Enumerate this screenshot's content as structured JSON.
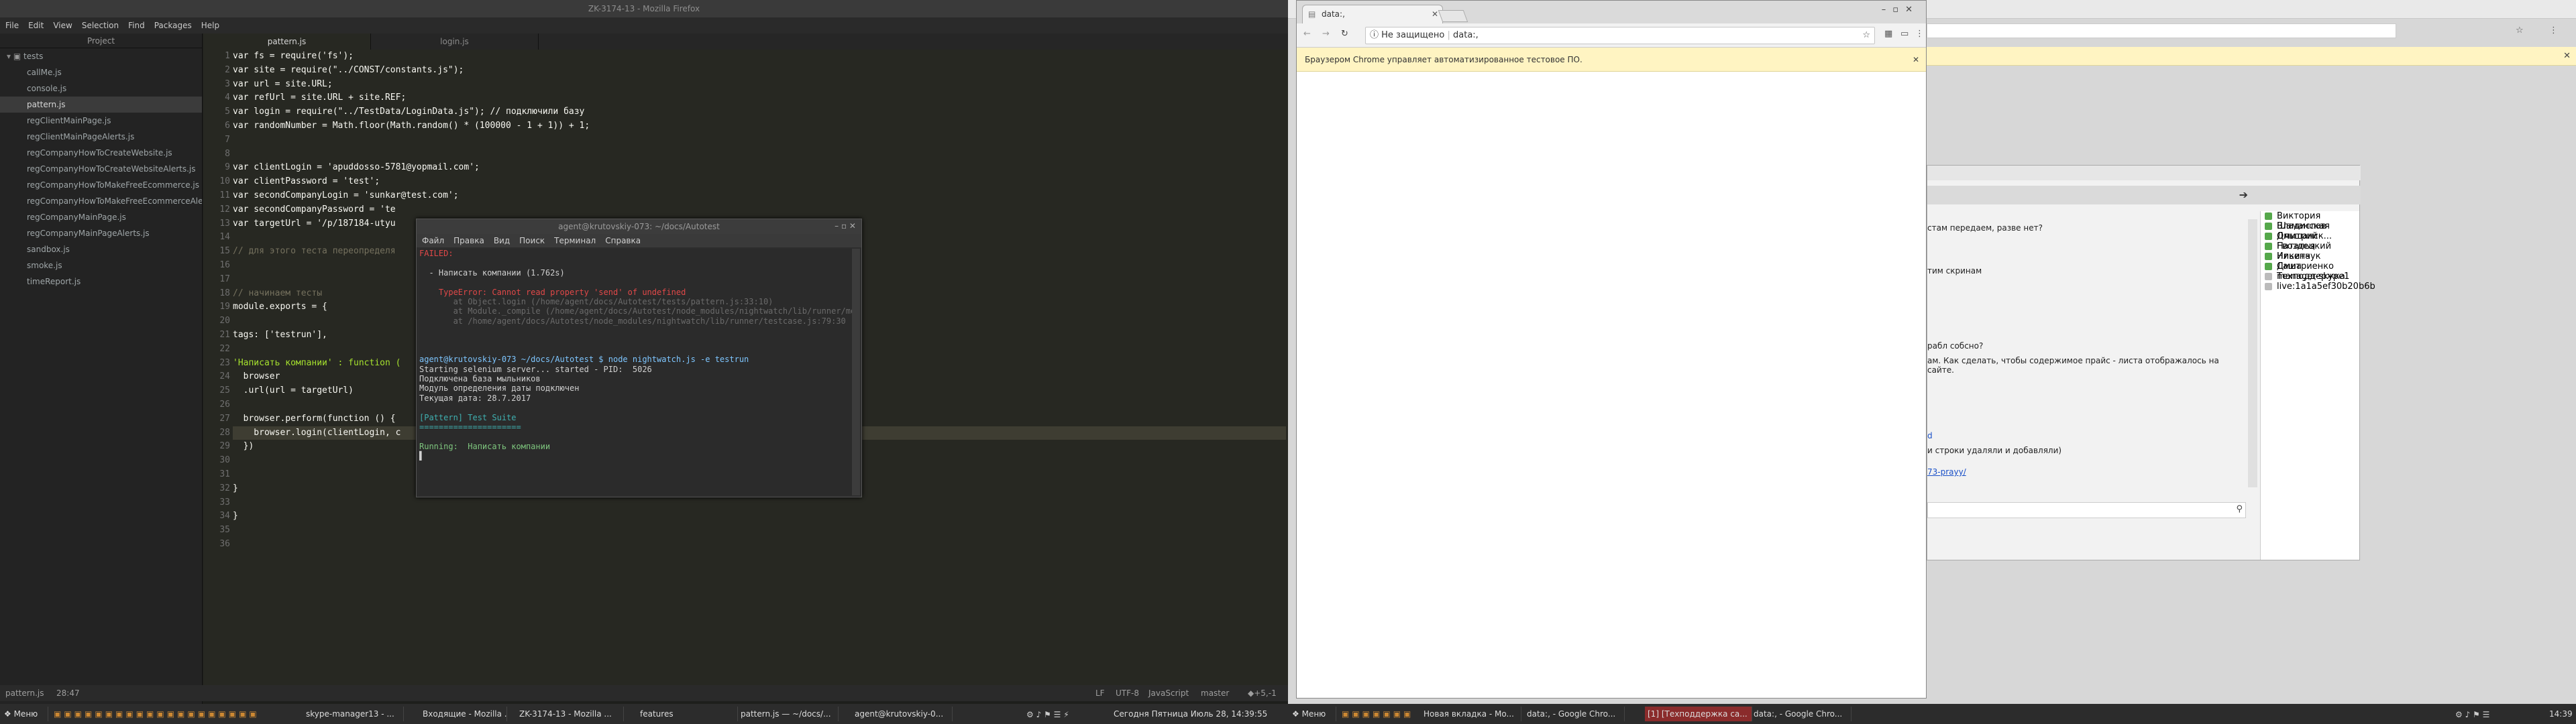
{
  "atom": {
    "window_title": "ZK-3174-13 - Mozilla Firefox",
    "menu": [
      "File",
      "Edit",
      "View",
      "Selection",
      "Find",
      "Packages",
      "Help"
    ],
    "tree_header": "Project",
    "tree_root": "tests",
    "files": [
      "callMe.js",
      "console.js",
      "pattern.js",
      "regClientMainPage.js",
      "regClientMainPageAlerts.js",
      "regCompanyHowToCreateWebsite.js",
      "regCompanyHowToCreateWebsiteAlerts.js",
      "regCompanyHowToMakeFreeEcommerce.js",
      "regCompanyHowToMakeFreeEcommerceAle",
      "regCompanyMainPage.js",
      "regCompanyMainPageAlerts.js",
      "sandbox.js",
      "smoke.js",
      "timeReport.js"
    ],
    "selected_file_index": 2,
    "tabs": [
      "pattern.js",
      "login.js"
    ],
    "code_lines": [
      "var fs = require('fs');",
      "var site = require(\"../CONST/constants.js\");",
      "var url = site.URL;",
      "var refUrl = site.URL + site.REF;",
      "var login = require(\"../TestData/LoginData.js\"); // подключили базу",
      "var randomNumber = Math.floor(Math.random() * (100000 - 1 + 1)) + 1;",
      "",
      "",
      "var clientLogin = 'apuddosso-5781@yopmail.com';",
      "var clientPassword = 'test';",
      "var secondCompanyLogin = 'sunkar@test.com';",
      "var secondCompanyPassword = 'te",
      "var targetUrl = '/p/187184-utyu",
      "",
      "// для этого теста переопределя",
      "",
      "",
      "// начинаем тесты",
      "module.exports = {",
      "",
      "tags: ['testrun'],",
      "",
      "'Написать компании' : function (",
      "  browser",
      "  .url(url = targetUrl)",
      "",
      "  browser.perform(function () {",
      "    browser.login(clientLogin, c",
      "  })",
      "",
      "",
      "}",
      "",
      "}",
      "",
      ""
    ],
    "status_left": "pattern.js",
    "status_pos": "28:47",
    "status_right": [
      "LF",
      "UTF-8",
      "JavaScript",
      "master",
      "◆+5,-1"
    ]
  },
  "terminal": {
    "title": "agent@krutovskiy-073: ~/docs/Autotest",
    "menu": [
      "Файл",
      "Правка",
      "Вид",
      "Поиск",
      "Терминал",
      "Справка"
    ],
    "lines": [
      "FAILED:",
      "",
      "  - Написать компании (1.762s)",
      "",
      "    TypeError: Cannot read property 'send' of undefined",
      "       at Object.login (/home/agent/docs/Autotest/tests/pattern.js:33:10)",
      "       at Module._compile (/home/agent/docs/Autotest/node_modules/nightwatch/lib/runner/module.js:51:15)",
      "       at /home/agent/docs/Autotest/node_modules/nightwatch/lib/runner/testcase.js:79:30",
      "",
      "",
      "",
      "agent@krutovskiy-073 ~/docs/Autotest $ node nightwatch.js -e testrun",
      "Starting selenium server... started - PID:  5026",
      "Подключена база мыльников",
      "Модуль определения даты подключен",
      "Текущая дата: 28.7.2017",
      "",
      "[Pattern] Test Suite",
      "=====================",
      "",
      "Running:  Написать компании",
      "▌"
    ]
  },
  "chrome": {
    "tab_title": "data:,",
    "omnibox_security": "Не защищено",
    "omnibox_url": "data:,",
    "infobar": "Браузером Chrome управляет автоматизированное тестовое ПО."
  },
  "skype": {
    "contacts": [
      "Виктория Шаманская",
      "Владислав Ольшанск...",
      "Дмитрий Гвоздецкий",
      "Наталья Ильенчук",
      "Никита Дмитриенко",
      "Саша  Техподдержка",
      "manager-skype1",
      "live:1a1a5ef30b20b6b"
    ],
    "chat_lines": [
      "стам передаем, разве нет?",
      "тим скринам",
      "рабл собсно?",
      "ам. Как сделать, чтобы содержимое прайс - листа отображалось на сайте.",
      "d",
      "и строки удаляли и добавляли)",
      "73-prayy/"
    ]
  },
  "taskbar_left": {
    "menu": "Меню",
    "items": [
      "skype-manager13 - ...",
      "Входящие - Mozilla ...",
      "ZK-3174-13 - Mozilla ...",
      "features",
      "pattern.js — ~/docs/...",
      "agent@krutovskiy-0..."
    ],
    "clock": "Сегодня Пятница Июль 28, 14:39:55"
  },
  "taskbar_right": {
    "menu": "Меню",
    "items": [
      "Новая вкладка - Mo...",
      "data:, - Google Chro...",
      "[1] [Техподдержка са...",
      "data:, - Google Chro..."
    ],
    "clock": "14:39"
  }
}
